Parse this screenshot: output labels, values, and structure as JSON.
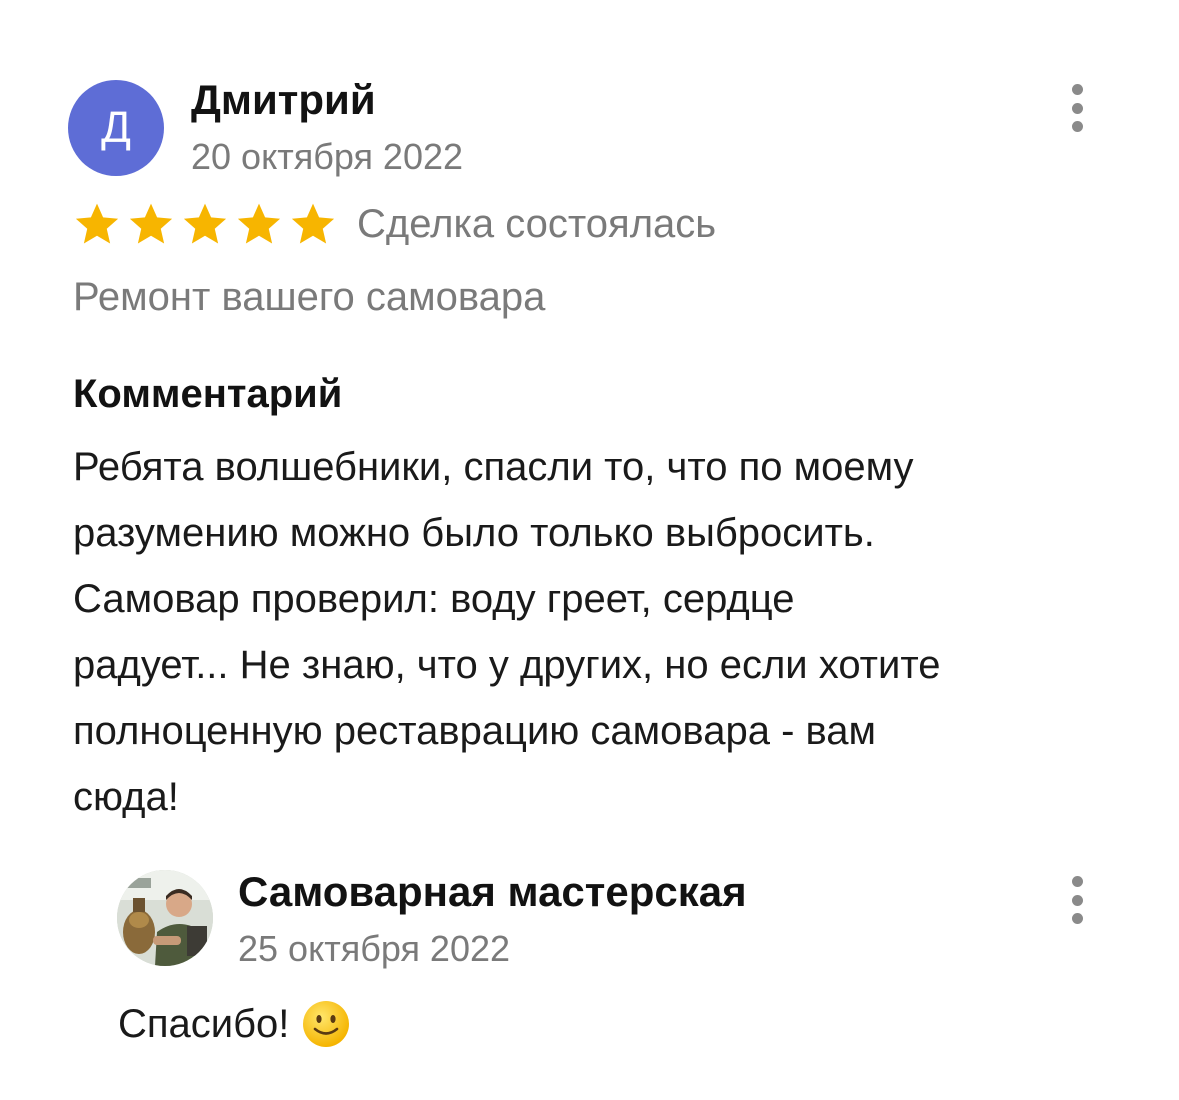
{
  "review": {
    "author": {
      "avatar_letter": "Д",
      "name": "Дмитрий",
      "date": "20 октября 2022"
    },
    "rating": 5,
    "rating_max": 5,
    "star_color": "#f7b500",
    "avatar_color": "#5e6dd6",
    "deal_status": "Сделка состоялась",
    "service": "Ремонт вашего самовара",
    "comment_heading": "Комментарий",
    "comment_lines": [
      "Ребята волшебники, спасли то, что по моему",
      "разумению можно было только выбросить.",
      "Самовар проверил: воду греет, сердце",
      "радует... Не знаю, что у других, но если хотите",
      "полноценную реставрацию самовара - вам",
      "сюда!"
    ],
    "more_icon": "more-vertical-icon"
  },
  "reply": {
    "name": "Самоварная мастерская",
    "date": "25 октября 2022",
    "text": "Спасибо!",
    "emoji_icon": "slightly-smiling-face-icon",
    "more_icon": "more-vertical-icon"
  }
}
